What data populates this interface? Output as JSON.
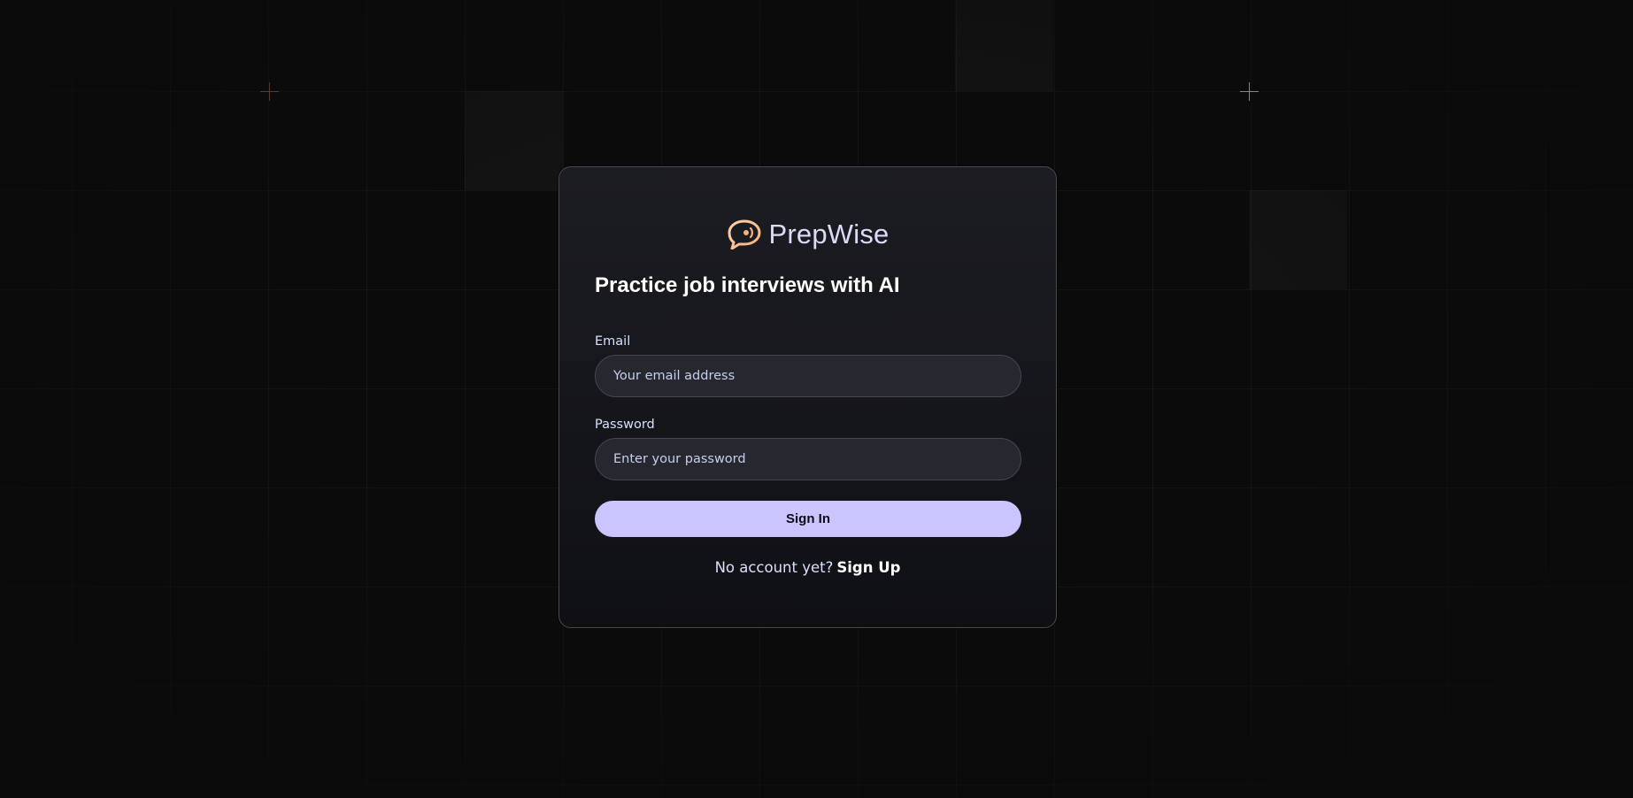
{
  "brand": {
    "name": "PrepWise",
    "logo_icon": "chat-bubble-logo-icon",
    "logo_color": "#f5b17c",
    "name_color": "#dcdaf6"
  },
  "auth": {
    "headline": "Practice job interviews with AI",
    "email": {
      "label": "Email",
      "placeholder": "Your email address",
      "value": ""
    },
    "password": {
      "label": "Password",
      "placeholder": "Enter your password",
      "value": ""
    },
    "submit_label": "Sign In",
    "footer_prompt": "No account yet?",
    "footer_link": "Sign Up"
  },
  "theme": {
    "background": "#0b0b0b",
    "card_top": "#1c1d22",
    "card_bottom": "#0f1014",
    "accent": "#cac5fe",
    "input_bg": "#26272f",
    "sparkle_color": "#f5b17c"
  }
}
